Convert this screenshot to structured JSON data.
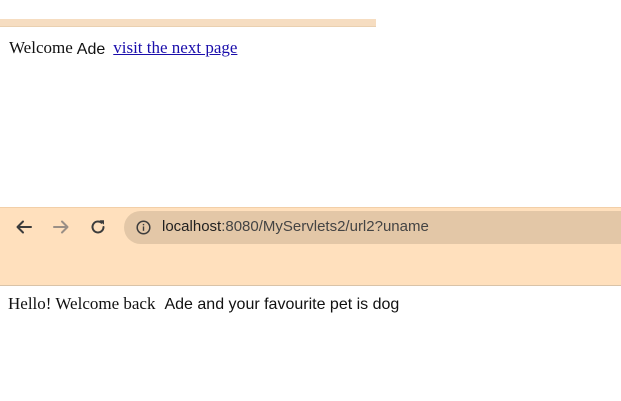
{
  "first_page": {
    "welcome_label": "Welcome",
    "user_name": "Ade",
    "next_link_text": "visit the next page"
  },
  "browser": {
    "url_host": "localhost",
    "url_rest": ":8080/MyServlets2/url2?uname",
    "chrome_color": "#ffe0bd"
  },
  "second_page": {
    "greeting": "Hello! Welcome back",
    "message": "Ade and your favourite pet is dog"
  },
  "icons": {
    "back": "arrow-left-icon",
    "forward": "arrow-right-icon",
    "reload": "reload-icon",
    "info": "info-icon"
  }
}
